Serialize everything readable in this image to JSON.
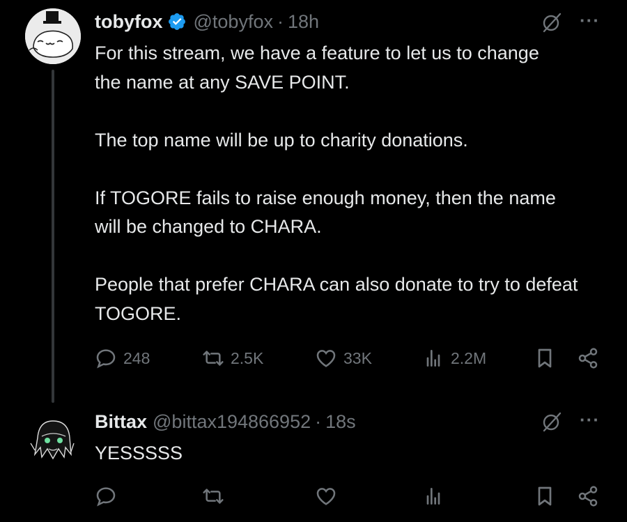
{
  "tweet1": {
    "name": "tobyfox",
    "handle": "@tobyfox",
    "separator": "·",
    "time": "18h",
    "paragraphs": [
      "For this stream, we have a feature to let us to change the name at any SAVE POINT.",
      "The top name will be up to charity donations.",
      "If TOGORE fails to raise enough money, then the name will be changed to CHARA.",
      "People that prefer CHARA can also donate to try to defeat TOGORE."
    ],
    "replies": "248",
    "reposts": "2.5K",
    "likes": "33K",
    "views": "2.2M",
    "more": "···"
  },
  "tweet2": {
    "name": "Bittax",
    "handle": "@bittax194866952",
    "separator": "·",
    "time": "18s",
    "text": "YESSSSS",
    "more": "···"
  },
  "colors": {
    "background": "#000000",
    "text": "#e7e9ea",
    "muted": "#71767b",
    "verified": "#1d9bf0"
  },
  "icons": [
    "reply-icon",
    "repost-icon",
    "like-icon",
    "views-icon",
    "bookmark-icon",
    "share-icon",
    "grok-icon",
    "verified-badge-icon",
    "more-icon"
  ]
}
